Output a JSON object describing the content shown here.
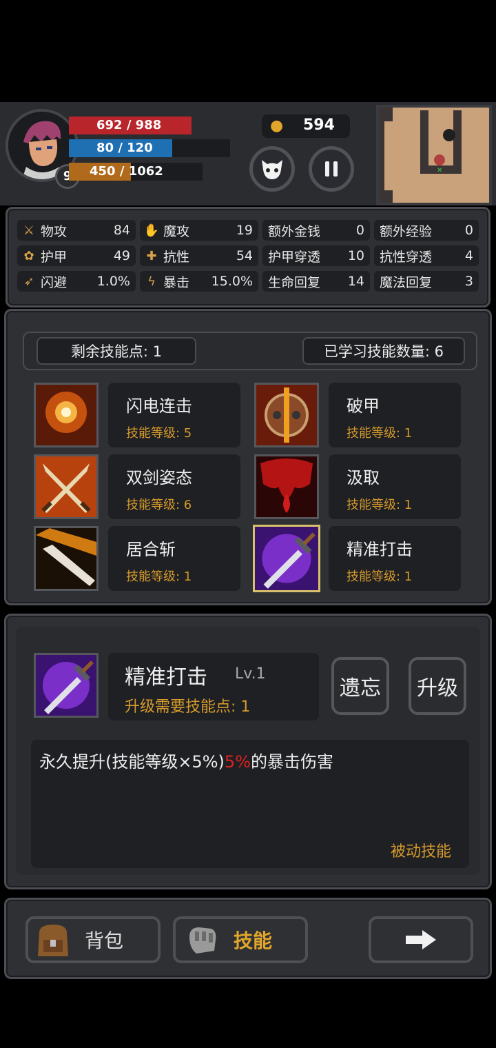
{
  "hud": {
    "hp_text": "692 / 988",
    "mp_text": "80 / 120",
    "xp_current": "450",
    "xp_total": "/ 1062",
    "level": "9",
    "gold": "594"
  },
  "stats": [
    {
      "icon": "sword-icon",
      "label": "物攻",
      "value": "84"
    },
    {
      "icon": "magic-hand-icon",
      "label": "魔攻",
      "value": "19"
    },
    {
      "icon": "",
      "label": "额外金钱",
      "value": "0"
    },
    {
      "icon": "",
      "label": "额外经验",
      "value": "0"
    },
    {
      "icon": "paw-shield-icon",
      "label": "护甲",
      "value": "49"
    },
    {
      "icon": "muscle-icon",
      "label": "抗性",
      "value": "54"
    },
    {
      "icon": "",
      "label": "护甲穿透",
      "value": "10"
    },
    {
      "icon": "",
      "label": "抗性穿透",
      "value": "4"
    },
    {
      "icon": "running-man-icon",
      "label": "闪避",
      "value": "1.0%"
    },
    {
      "icon": "lightning-icon",
      "label": "暴击",
      "value": "15.0%"
    },
    {
      "icon": "",
      "label": "生命回复",
      "value": "14"
    },
    {
      "icon": "",
      "label": "魔法回复",
      "value": "3"
    }
  ],
  "skills_header": {
    "remaining": "剩余技能点: 1",
    "learned": "已学习技能数量: 6"
  },
  "skills": [
    {
      "name": "闪电连击",
      "level": "技能等级: 5",
      "icon": "lightning-burst-icon",
      "color": "#e07a14"
    },
    {
      "name": "破甲",
      "level": "技能等级: 1",
      "icon": "broken-shield-icon",
      "color": "#c0561a"
    },
    {
      "name": "双剑姿态",
      "level": "技能等级: 6",
      "icon": "crossed-swords-icon",
      "color": "#d4661a"
    },
    {
      "name": "汲取",
      "level": "技能等级: 1",
      "icon": "blood-drain-icon",
      "color": "#b01414"
    },
    {
      "name": "居合斩",
      "level": "技能等级: 1",
      "icon": "blade-slash-icon",
      "color": "#d9881a"
    },
    {
      "name": "精准打击",
      "level": "技能等级: 1",
      "icon": "purple-sword-icon",
      "color": "#7a2fc9"
    }
  ],
  "detail": {
    "name": "精准打击",
    "lv": "Lv.1",
    "requirement": "升级需要技能点: 1",
    "forget_label": "遗忘",
    "upgrade_label": "升级",
    "desc_prefix": "永久提升(技能等级×5%)",
    "desc_highlight": "5%",
    "desc_suffix": "的暴击伤害",
    "type": "被动技能"
  },
  "nav": {
    "bag_label": "背包",
    "skills_label": "技能",
    "next_icon": "arrow-right-icon"
  },
  "colors": {
    "accent": "#d59a2b",
    "highlight": "#e02020",
    "hp": "#b8262b",
    "mp": "#1f6fb3",
    "xp": "#b06a1c"
  }
}
